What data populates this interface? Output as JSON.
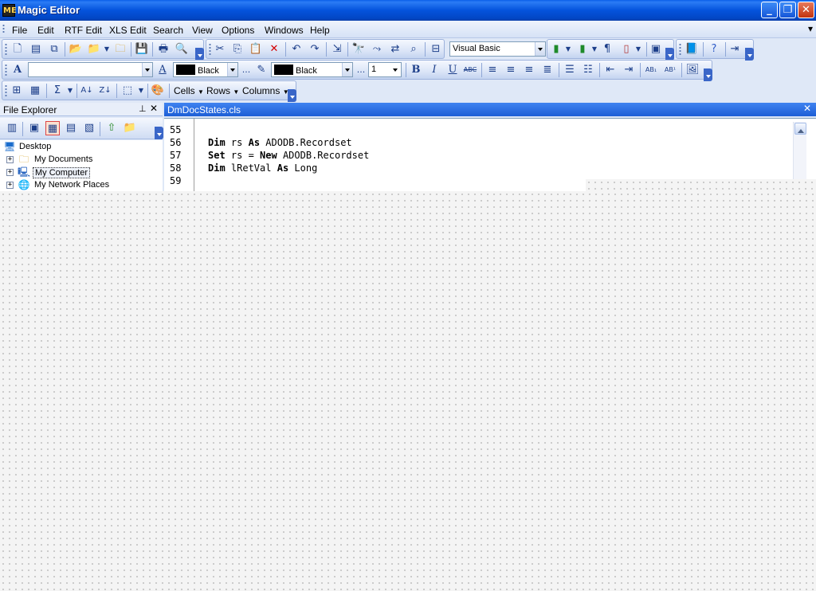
{
  "window": {
    "title": "Magic Editor",
    "icon_text": "ME",
    "controls": [
      "minimize-icon",
      "restore-icon",
      "close-icon"
    ]
  },
  "menu": {
    "items": [
      {
        "label": "File"
      },
      {
        "label": "Edit"
      },
      {
        "label": "RTF Edit"
      },
      {
        "label": "XLS Edit"
      },
      {
        "label": "Search"
      },
      {
        "label": "View"
      },
      {
        "label": "Options"
      },
      {
        "label": "Windows"
      },
      {
        "label": "Help"
      }
    ]
  },
  "toolbar": {
    "language": "Visual Basic",
    "font_name": "",
    "font_color": "Black",
    "highlight_color": "Black",
    "size_value": "1",
    "more_label": "...",
    "cells_label": "Cells",
    "rows_label": "Rows",
    "columns_label": "Columns"
  },
  "explorer": {
    "title": "File Explorer",
    "tree": [
      {
        "label": "Desktop",
        "icon": "desktop-icon"
      },
      {
        "label": "My Documents",
        "icon": "folder-icon"
      },
      {
        "label": "My Computer",
        "icon": "computer-icon",
        "selected": true
      },
      {
        "label": "My Network Places",
        "icon": "network-icon"
      }
    ]
  },
  "document": {
    "tab_title": "DmDocStates.cls",
    "lines": [
      {
        "num": "55",
        "parts": []
      },
      {
        "num": "56",
        "parts": [
          {
            "t": "Dim",
            "kw": true
          },
          {
            "t": " rs "
          },
          {
            "t": "As",
            "kw": true
          },
          {
            "t": " ADODB.Recordset"
          }
        ]
      },
      {
        "num": "57",
        "parts": [
          {
            "t": "Set",
            "kw": true
          },
          {
            "t": " rs = "
          },
          {
            "t": "New",
            "kw": true
          },
          {
            "t": " ADODB.Recordset"
          }
        ]
      },
      {
        "num": "58",
        "parts": [
          {
            "t": "Dim",
            "kw": true
          },
          {
            "t": " lRetVal "
          },
          {
            "t": "As",
            "kw": true
          },
          {
            "t": " Long"
          }
        ]
      },
      {
        "num": "59",
        "parts": []
      }
    ]
  },
  "colors": {
    "title_bar": "#0453dc",
    "doc_tab": "#1d5fd6",
    "toolbar_bg": "#dbe5f7"
  }
}
